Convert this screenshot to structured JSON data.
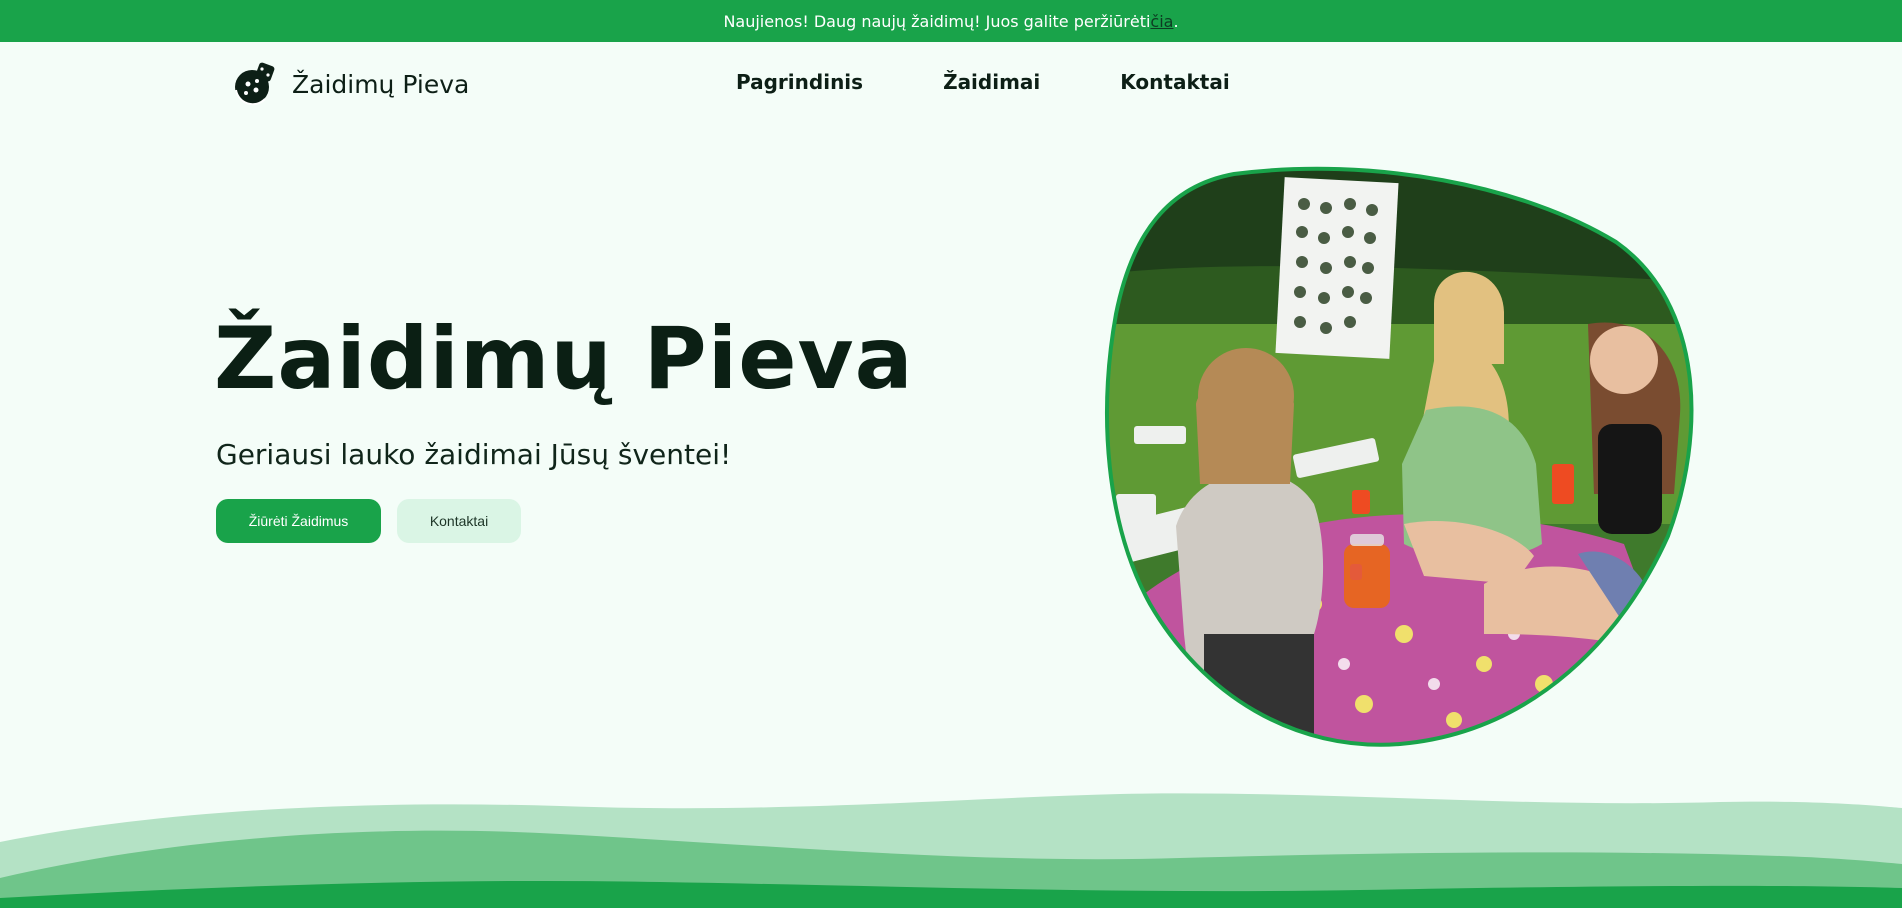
{
  "announcement": {
    "text": "Naujienos! Daug naujų žaidimų! Juos galite peržiūrėti ",
    "link_text": "čia",
    "suffix": "."
  },
  "header": {
    "brand": "Žaidimų Pieva",
    "logo_icon": "dice-ball-icon",
    "nav": [
      "Pagrindinis",
      "Žaidimai",
      "Kontaktai"
    ]
  },
  "hero": {
    "title": "Žaidimų Pieva",
    "subtitle": "Geriausi lauko žaidimai Jūsų šventei!",
    "primary_button": "Žiūrėti Žaidimus",
    "secondary_button": "Kontaktai",
    "image_icon": "photo-picnic-icon"
  },
  "colors": {
    "brand_green": "#19a34a",
    "background": "#f4fdf8",
    "secondary_button": "#daf5e5",
    "wave_light": "#b4e2c5",
    "wave_mid": "#6fc58a",
    "wave_dark": "#19a34a"
  }
}
